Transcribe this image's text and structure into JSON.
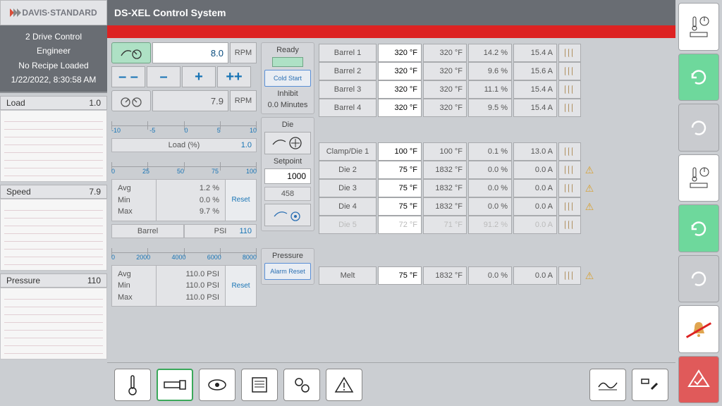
{
  "logo_text": "DAVIS·STANDARD",
  "info": {
    "line1": "2 Drive Control",
    "line2": "Engineer",
    "line3": "No Recipe Loaded",
    "line4": "1/22/2022, 8:30:58 AM"
  },
  "title": "DS-XEL Control System",
  "trends": [
    {
      "label": "Load",
      "value": "1.0"
    },
    {
      "label": "Speed",
      "value": "7.9"
    },
    {
      "label": "Pressure",
      "value": "110"
    }
  ],
  "speed1": {
    "value": "8.0",
    "unit": "RPM"
  },
  "decdec": "– –",
  "dec": "–",
  "inc": "+",
  "incinc": "++",
  "speed2": {
    "value": "7.9",
    "unit": "RPM"
  },
  "scaleA": [
    "-10",
    "-5",
    "0",
    "5",
    "10"
  ],
  "load": {
    "label": "Load (%)",
    "num": "1.0",
    "scale": [
      "0",
      "25",
      "50",
      "75",
      "100"
    ],
    "avg": "1.2 %",
    "min": "0.0 %",
    "max": "9.7 %"
  },
  "barrel": {
    "h1": "Barrel",
    "h2": "PSI",
    "num": "110",
    "scale": [
      "0",
      "2000",
      "4000",
      "6000",
      "8000"
    ],
    "avg": "110.0 PSI",
    "min": "110.0 PSI",
    "max": "110.0 PSI"
  },
  "reset": "Reset",
  "avg": "Avg",
  "min": "Min",
  "max": "Max",
  "ready": {
    "title": "Ready",
    "btn": "Cold Start",
    "inhibit": "Inhibit",
    "minutes": "0.0 Minutes"
  },
  "die": {
    "title": "Die",
    "setpoint": "Setpoint",
    "value": "1000",
    "code": "458"
  },
  "pressure": {
    "title": "Pressure",
    "btn": "Alarm Reset"
  },
  "zones_top": [
    {
      "name": "Barrel 1",
      "sp": "320 °F",
      "pv": "320 °F",
      "pct": "14.2 %",
      "amp": "15.4 A",
      "warn": false,
      "dim": false
    },
    {
      "name": "Barrel 2",
      "sp": "320 °F",
      "pv": "320 °F",
      "pct": "9.6 %",
      "amp": "15.6 A",
      "warn": false,
      "dim": false
    },
    {
      "name": "Barrel 3",
      "sp": "320 °F",
      "pv": "320 °F",
      "pct": "11.1 %",
      "amp": "15.4 A",
      "warn": false,
      "dim": false
    },
    {
      "name": "Barrel 4",
      "sp": "320 °F",
      "pv": "320 °F",
      "pct": "9.5 %",
      "amp": "15.4 A",
      "warn": false,
      "dim": false
    }
  ],
  "zones_bot": [
    {
      "name": "Clamp/Die 1",
      "sp": "100 °F",
      "pv": "100 °F",
      "pct": "0.1 %",
      "amp": "13.0 A",
      "warn": false,
      "dim": false
    },
    {
      "name": "Die 2",
      "sp": "75 °F",
      "pv": "1832 °F",
      "pct": "0.0 %",
      "amp": "0.0 A",
      "warn": true,
      "dim": false
    },
    {
      "name": "Die 3",
      "sp": "75 °F",
      "pv": "1832 °F",
      "pct": "0.0 %",
      "amp": "0.0 A",
      "warn": true,
      "dim": false
    },
    {
      "name": "Die 4",
      "sp": "75 °F",
      "pv": "1832 °F",
      "pct": "0.0 %",
      "amp": "0.0 A",
      "warn": true,
      "dim": false
    },
    {
      "name": "Die 5",
      "sp": "72 °F",
      "pv": "71 °F",
      "pct": "91.2 %",
      "amp": "0.0 A",
      "warn": false,
      "dim": true
    }
  ],
  "melt": {
    "name": "Melt",
    "sp": "75 °F",
    "pv": "1832 °F",
    "pct": "0.0 %",
    "amp": "0.0 A",
    "warn": true,
    "dim": false
  }
}
